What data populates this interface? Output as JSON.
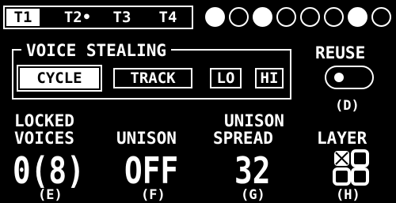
{
  "tabs": [
    {
      "label": "T1",
      "active": true
    },
    {
      "label": "T2•",
      "active": false
    },
    {
      "label": "T3",
      "active": false
    },
    {
      "label": "T4",
      "active": false
    }
  ],
  "slots": [
    true,
    false,
    true,
    false,
    false,
    false,
    true,
    false
  ],
  "voice_stealing": {
    "title": "VOICE STEALING",
    "options": [
      "CYCLE",
      "TRACK",
      "LO",
      "HI"
    ],
    "selected": "CYCLE"
  },
  "reuse": {
    "label": "REUSE",
    "key": "(D)",
    "state": "off"
  },
  "params": [
    {
      "label_line1": "LOCKED",
      "label_line2": "VOICES",
      "value": "0(8)",
      "key": "(E)"
    },
    {
      "label_line1": "",
      "label_line2": "UNISON",
      "value": "OFF",
      "key": "(F)"
    },
    {
      "label_line1": "UNISON",
      "label_line2": "SPREAD",
      "value": "32",
      "key": "(G)"
    },
    {
      "label_line1": "",
      "label_line2": "LAYER",
      "value": "",
      "key": "(H)"
    }
  ],
  "icons": {
    "layer": "layer-grid-icon"
  }
}
